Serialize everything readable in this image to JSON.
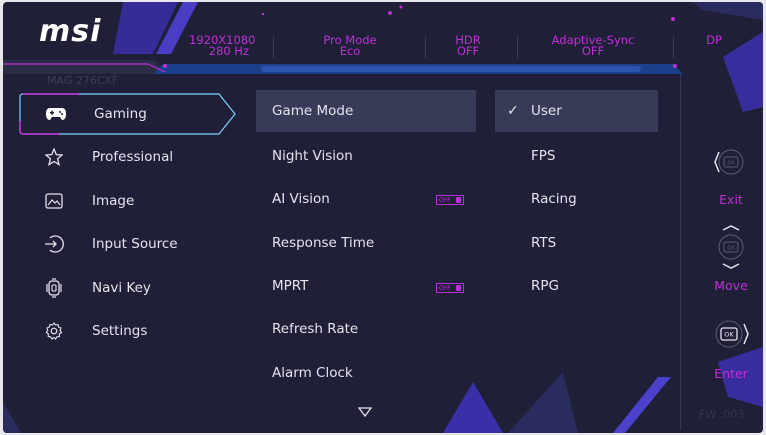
{
  "brand": "msi",
  "model": "MAG 276CXF",
  "header": {
    "items": [
      {
        "line1": "1920X1080",
        "line2": "280 Hz"
      },
      {
        "line1": "Pro Mode",
        "line2": "Eco"
      },
      {
        "line1": "HDR",
        "line2": "OFF"
      },
      {
        "line1": "Adaptive-Sync",
        "line2": "OFF"
      },
      {
        "line1": "DP",
        "line2": ""
      }
    ]
  },
  "main_menu": [
    {
      "label": "Gaming",
      "icon": "gamepad-icon"
    },
    {
      "label": "Professional",
      "icon": "star-icon"
    },
    {
      "label": "Image",
      "icon": "image-icon"
    },
    {
      "label": "Input Source",
      "icon": "input-source-icon"
    },
    {
      "label": "Navi Key",
      "icon": "navi-key-icon"
    },
    {
      "label": "Settings",
      "icon": "gear-icon"
    }
  ],
  "submenu": [
    {
      "label": "Game Mode"
    },
    {
      "label": "Night Vision"
    },
    {
      "label": "AI Vision",
      "badge": "OFF"
    },
    {
      "label": "Response Time"
    },
    {
      "label": "MPRT",
      "badge": "OFF"
    },
    {
      "label": "Refresh Rate"
    },
    {
      "label": "Alarm Clock"
    }
  ],
  "options": [
    {
      "label": "User",
      "checked": "✓"
    },
    {
      "label": "FPS"
    },
    {
      "label": "Racing"
    },
    {
      "label": "RTS"
    },
    {
      "label": "RPG"
    }
  ],
  "nav": {
    "exit": "Exit",
    "move": "Move",
    "enter": "Enter",
    "ok": "OK"
  },
  "firmware": "FW .003",
  "colors": {
    "background": "#1f2038",
    "accent": "#c02fd6",
    "highlight": "#373b58",
    "active_border": "#7ad0ff"
  }
}
